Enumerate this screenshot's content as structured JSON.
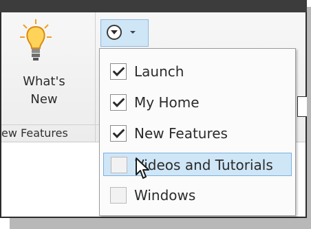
{
  "ribbon": {
    "whats_new_line1": "What's",
    "whats_new_line2": "New",
    "group_label": "ew Features"
  },
  "menu": {
    "items": [
      {
        "label": "Launch",
        "checked": true
      },
      {
        "label": "My Home",
        "checked": true
      },
      {
        "label": "New Features",
        "checked": true
      },
      {
        "label": "Videos and Tutorials",
        "checked": false,
        "highlighted": true
      },
      {
        "label": "Windows",
        "checked": false
      }
    ]
  },
  "colors": {
    "highlight": "#cfe6f7",
    "highlight_border": "#79b0e0"
  },
  "icons": [
    "lightbulb-icon",
    "circle-dropdown-icon",
    "chevron-down-icon",
    "checkbox-icon",
    "mouse-pointer-icon"
  ]
}
